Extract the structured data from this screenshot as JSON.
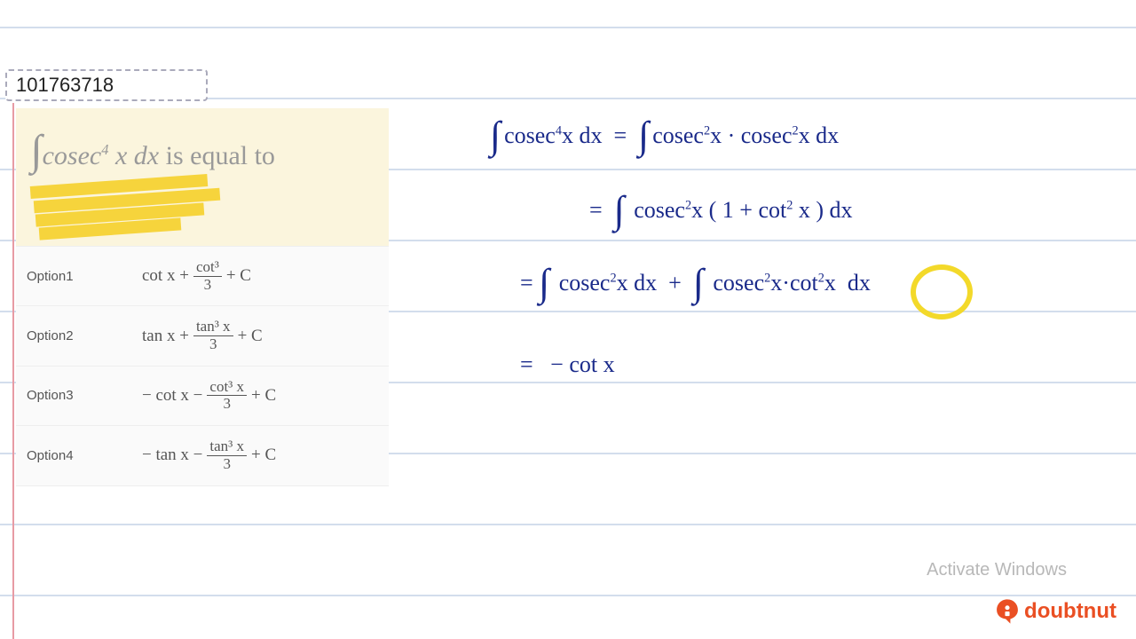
{
  "question_id": "101763718",
  "question": {
    "integral_expr": "∫cosec⁴ x dx",
    "suffix": " is equal to"
  },
  "options": [
    {
      "label": "Option1",
      "math_prefix": "cot x + ",
      "frac_num": "cot³",
      "frac_den": "3",
      "math_suffix": " + C"
    },
    {
      "label": "Option2",
      "math_prefix": "tan x + ",
      "frac_num": "tan³ x",
      "frac_den": "3",
      "math_suffix": " + C"
    },
    {
      "label": "Option3",
      "math_prefix": "− cot x − ",
      "frac_num": "cot³ x",
      "frac_den": "3",
      "math_suffix": " + C"
    },
    {
      "label": "Option4",
      "math_prefix": "− tan x − ",
      "frac_num": "tan³ x",
      "frac_den": "3",
      "math_suffix": " + C"
    }
  ],
  "handwriting": {
    "line1": "∫cosec⁴x dx  =  ∫cosec²x · cosec²x dx",
    "line2": "=  ∫ cosec²x ( 1 + cot² x ) dx",
    "line3": "=  ∫ cosec²x dx  +  ∫ cosec²x · cot²x  dx",
    "line4": "=   − cot x"
  },
  "watermark": "Activate Windows",
  "brand": "doubtnut"
}
